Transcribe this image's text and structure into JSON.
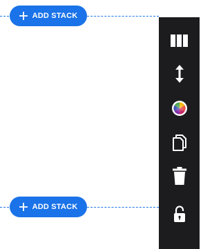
{
  "stacks": {
    "add_top_label": "ADD STACK",
    "add_bottom_label": "ADD STACK"
  },
  "toolbar": {
    "items": [
      {
        "name": "columns-layout",
        "icon": "columns-icon"
      },
      {
        "name": "resize-height",
        "icon": "vertical-resize-icon"
      },
      {
        "name": "color-picker",
        "icon": "color-wheel-icon"
      },
      {
        "name": "duplicate",
        "icon": "copy-icon"
      },
      {
        "name": "delete",
        "icon": "trash-icon"
      },
      {
        "name": "lock-toggle",
        "icon": "unlock-icon"
      }
    ]
  },
  "colors": {
    "accent": "#1a73e8",
    "toolbar_bg": "#1c1c1e",
    "icon": "#ffffff"
  }
}
